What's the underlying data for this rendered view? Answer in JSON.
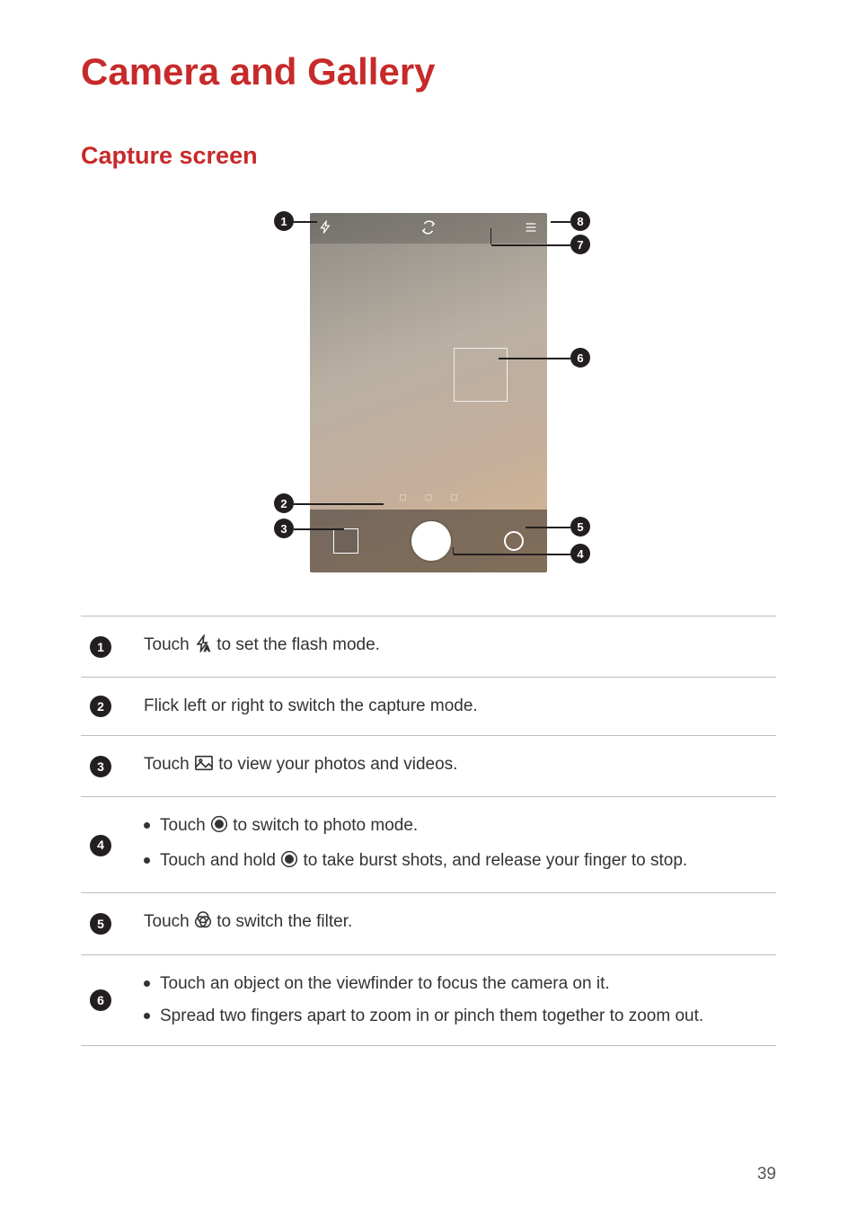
{
  "page": {
    "title": "Camera and Gallery",
    "section": "Capture screen",
    "page_number": "39"
  },
  "callouts": [
    "1",
    "2",
    "3",
    "4",
    "5",
    "6",
    "7",
    "8"
  ],
  "table": {
    "rows": [
      {
        "num": "1",
        "text_before": "Touch ",
        "icon": "flash",
        "text_after": " to set the flash mode."
      },
      {
        "num": "2",
        "plain": "Flick left or right to switch the capture mode."
      },
      {
        "num": "3",
        "text_before": "Touch ",
        "icon": "gallery",
        "text_after": " to view your photos and videos."
      },
      {
        "num": "4",
        "bullets": [
          {
            "before": "Touch ",
            "icon": "shutter",
            "after": " to switch to photo mode."
          },
          {
            "before": "Touch and hold ",
            "icon": "shutter",
            "after": " to take burst shots, and release your finger to stop."
          }
        ]
      },
      {
        "num": "5",
        "text_before": "Touch ",
        "icon": "filter",
        "text_after": " to switch the filter."
      },
      {
        "num": "6",
        "bullets": [
          {
            "plain": "Touch an object on the viewfinder to focus the camera on it."
          },
          {
            "plain": "Spread two fingers apart to zoom in or pinch them together to zoom out."
          }
        ]
      }
    ]
  }
}
